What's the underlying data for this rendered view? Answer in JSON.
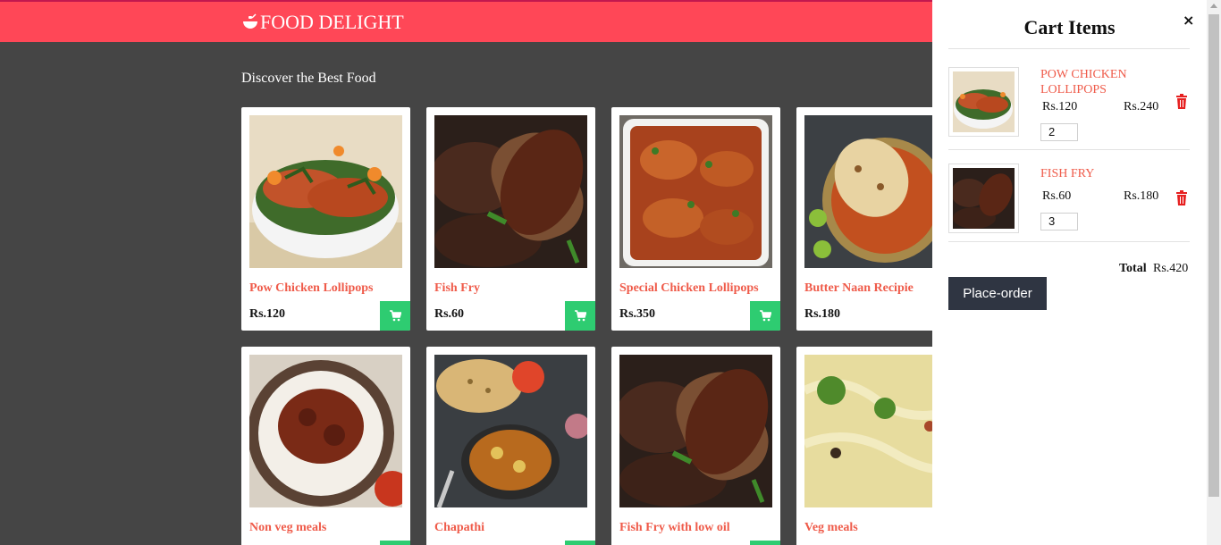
{
  "header": {
    "brand": "FOOD DELIGHT",
    "logo_icon": "food-bowl-icon",
    "color": "#ff4757"
  },
  "section_title": "Discover the Best Food",
  "products": [
    {
      "name": "Pow Chicken Lollipops",
      "price": "Rs.120"
    },
    {
      "name": "Fish Fry",
      "price": "Rs.60"
    },
    {
      "name": "Special Chicken Lollipops",
      "price": "Rs.350"
    },
    {
      "name": "Butter Naan Recipie",
      "price": "Rs.180"
    },
    {
      "name": "Non veg meals",
      "price": ""
    },
    {
      "name": "Chapathi",
      "price": ""
    },
    {
      "name": "Fish Fry with low oil",
      "price": ""
    },
    {
      "name": "Veg meals",
      "price": ""
    }
  ],
  "cart": {
    "title": "Cart Items",
    "close_label": "×",
    "items": [
      {
        "name": "POW CHICKEN LOLLIPOPS",
        "unit_price": "Rs.120",
        "subtotal": "Rs.240",
        "quantity": "2"
      },
      {
        "name": "FISH FRY",
        "unit_price": "Rs.60",
        "subtotal": "Rs.180",
        "quantity": "3"
      }
    ],
    "total_label": "Total",
    "total_value": "Rs.420",
    "place_order_label": "Place-order"
  },
  "colors": {
    "accent": "#ff4757",
    "add_to_cart": "#2ecc71",
    "product_name": "#ef5b4a",
    "order_button": "#2f3542"
  },
  "icons": {
    "add_to_cart": "cart-icon",
    "remove": "trash-icon",
    "close": "close-icon"
  }
}
